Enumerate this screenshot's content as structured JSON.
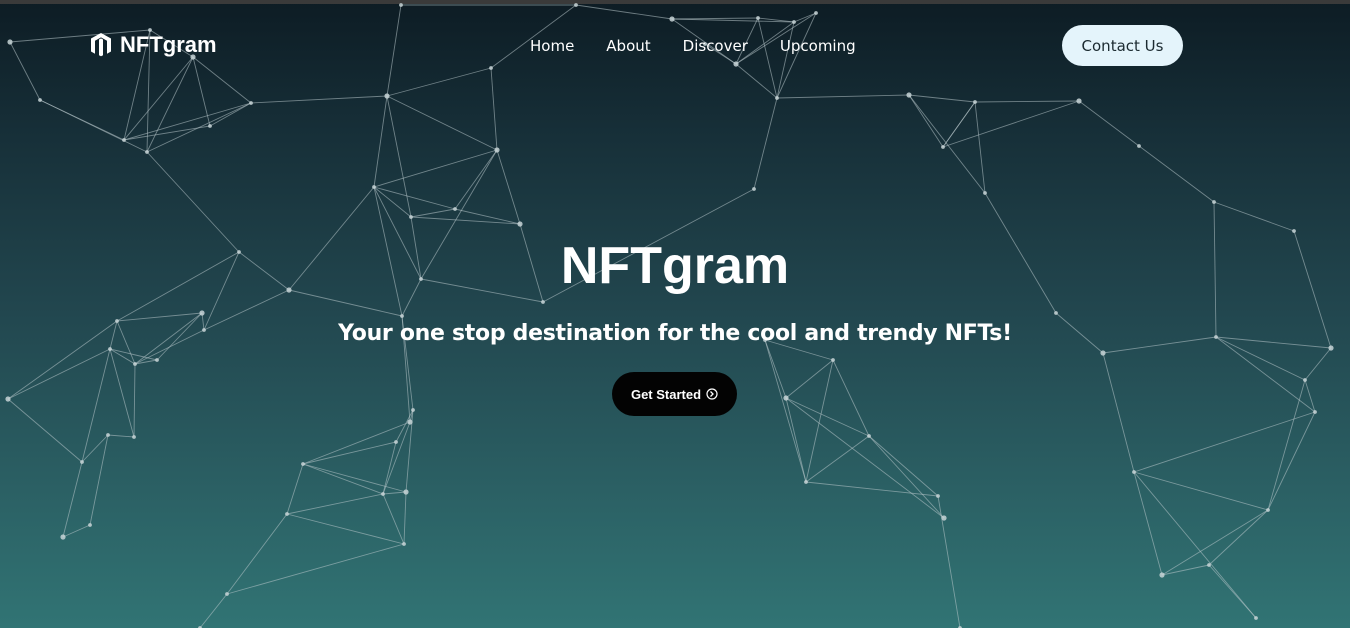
{
  "brand": {
    "name": "NFTgram",
    "logo_icon": "hexagon-m-logo-icon"
  },
  "nav": {
    "items": [
      {
        "label": "Home"
      },
      {
        "label": "About"
      },
      {
        "label": "Discover"
      },
      {
        "label": "Upcoming"
      }
    ],
    "contact_label": "Contact Us"
  },
  "hero": {
    "title": "NFTgram",
    "subtitle": "Your one stop destination for the cool and trendy NFTs!",
    "cta_label": "Get Started",
    "cta_icon": "arrow-circle-right-icon"
  },
  "colors": {
    "background_top": "#0d1c24",
    "background_bottom": "#317474",
    "contact_button_bg": "#e4f4fb",
    "cta_button_bg": "#030303",
    "network_line": "#b9c8cc",
    "network_node": "#c7d3d6"
  }
}
